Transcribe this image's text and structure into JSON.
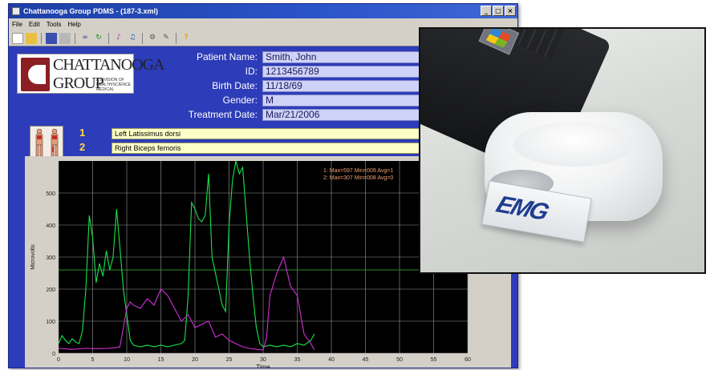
{
  "window": {
    "title": "Chattanooga Group PDMS - (187-3.xml)",
    "controls": [
      "_",
      "□",
      "×"
    ]
  },
  "menu": [
    "File",
    "Edit",
    "Tools",
    "Help"
  ],
  "logo": {
    "line1": "CHATTANOOGA",
    "line2": "GROUP",
    "tagline": "A DIVISION OF HEALTH/SCIENCE MEDICAL"
  },
  "patient": {
    "name_label": "Patient Name:",
    "name": "Smith, John",
    "id_label": "ID:",
    "id": "1213456789",
    "birth_label": "Birth Date:",
    "birth": "11/18/69",
    "gender_label": "Gender:",
    "gender": "M",
    "treatment_label": "Treatment Date:",
    "treatment": "Mar/21/2006"
  },
  "muscles": [
    {
      "num": "1",
      "name": "Left Latissimus dorsi"
    },
    {
      "num": "2",
      "name": "Right Biceps femoris"
    }
  ],
  "chart_data": {
    "type": "line",
    "xlabel": "Time",
    "ylabel": "Microvolts",
    "xlim": [
      0,
      60
    ],
    "ylim": [
      0,
      600
    ],
    "xticks": [
      0,
      5,
      10,
      15,
      20,
      25,
      30,
      35,
      40,
      45,
      50,
      55,
      60
    ],
    "yticks": [
      0,
      100,
      200,
      300,
      400,
      500
    ],
    "threshold": 260,
    "grid": true,
    "legend_lines": [
      "1: Max=597 Min=009 Avg=1",
      "2: Max=307 Min=008 Avg=0"
    ],
    "series": [
      {
        "color": "#18e44a",
        "x": [
          0,
          0.5,
          1,
          1.5,
          2,
          2.5,
          3,
          3.5,
          4,
          4.5,
          5,
          5.5,
          6,
          6.5,
          7,
          7.5,
          8,
          8.5,
          9,
          9.5,
          10,
          10.5,
          11,
          12,
          13,
          14,
          15,
          16,
          17,
          18,
          18.5,
          19,
          19.5,
          20,
          20.5,
          21,
          21.5,
          22,
          22.5,
          23,
          23.5,
          24,
          24.5,
          25,
          25.5,
          26,
          26.5,
          27,
          27.5,
          28,
          28.5,
          29,
          29.5,
          30,
          31,
          32,
          33,
          34,
          35,
          36,
          37,
          37.5
        ],
        "y": [
          30,
          55,
          40,
          30,
          45,
          35,
          30,
          70,
          200,
          430,
          360,
          220,
          280,
          240,
          320,
          260,
          300,
          450,
          330,
          200,
          120,
          40,
          25,
          20,
          25,
          20,
          25,
          20,
          25,
          30,
          40,
          180,
          470,
          450,
          420,
          410,
          430,
          560,
          300,
          250,
          200,
          150,
          130,
          400,
          540,
          600,
          560,
          580,
          440,
          300,
          180,
          80,
          30,
          20,
          25,
          20,
          25,
          20,
          30,
          25,
          40,
          60
        ]
      },
      {
        "color": "#d030d8",
        "x": [
          0,
          2,
          4,
          6,
          8,
          9,
          9.5,
          10,
          10.5,
          11,
          12,
          13,
          14,
          15,
          16,
          17,
          18,
          19,
          20,
          21,
          22,
          23,
          24,
          25,
          26,
          27,
          28,
          29,
          30,
          30.5,
          31,
          32,
          33,
          34,
          35,
          36,
          37,
          37.5
        ],
        "y": [
          15,
          12,
          15,
          14,
          16,
          20,
          80,
          140,
          160,
          150,
          140,
          170,
          150,
          200,
          180,
          140,
          100,
          120,
          80,
          90,
          100,
          50,
          60,
          40,
          30,
          20,
          15,
          12,
          10,
          50,
          180,
          250,
          300,
          210,
          180,
          60,
          30,
          10
        ]
      }
    ]
  },
  "photo": {
    "card_text": "EMG"
  }
}
